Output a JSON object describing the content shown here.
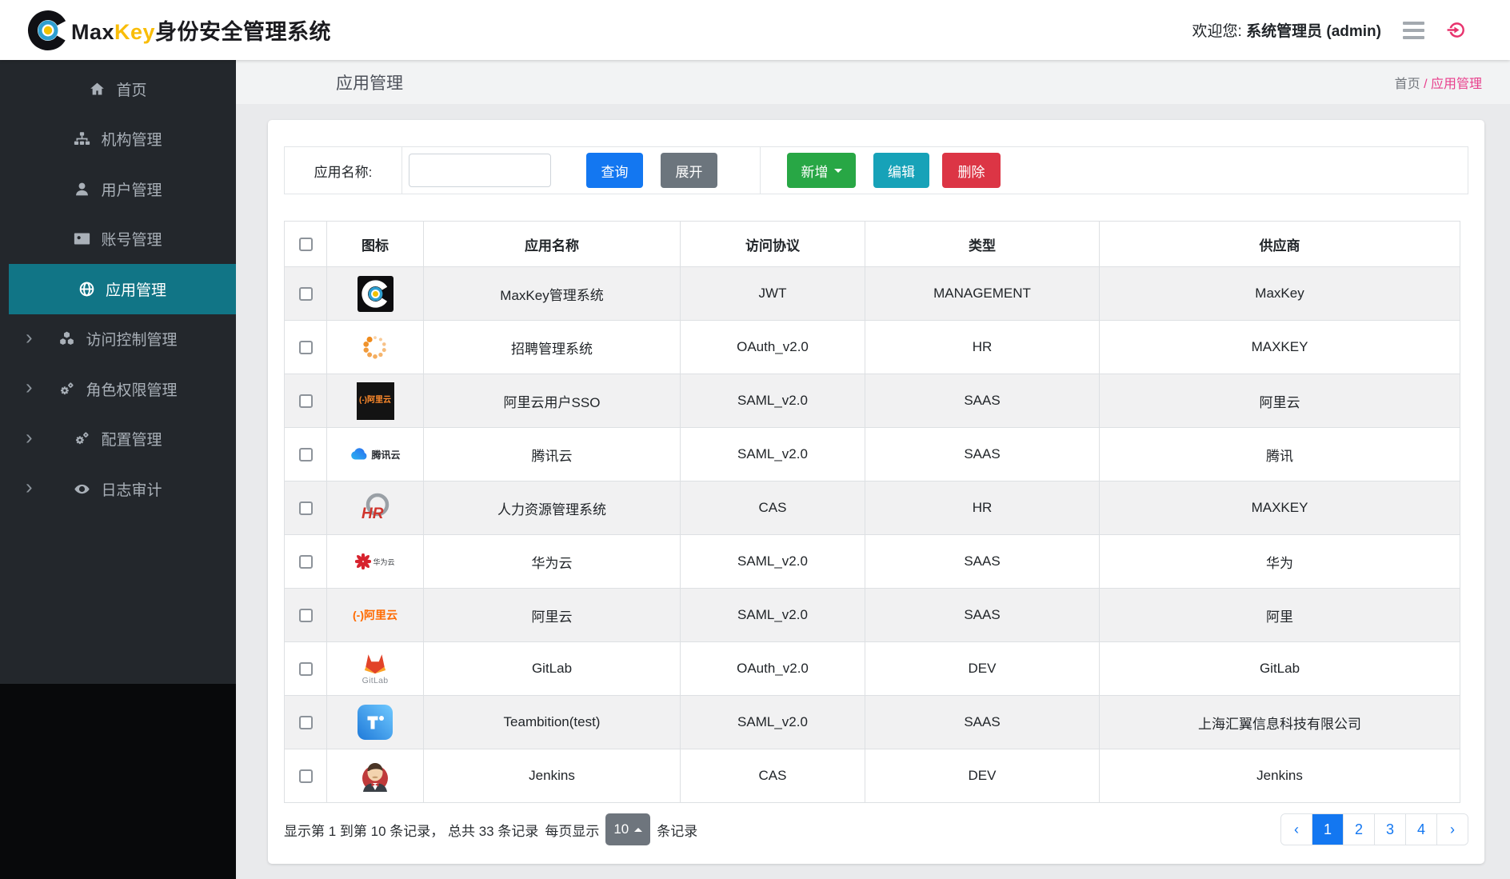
{
  "header": {
    "brand_prefix": "Max",
    "brand_highlight": "Key",
    "brand_suffix": "身份安全管理系统",
    "welcome_prefix": "欢迎您:",
    "welcome_user": "系统管理员 (admin)"
  },
  "icons": {
    "chevron_right": "›"
  },
  "colors": {
    "primary": "#1377f1",
    "secondary": "#6c757d",
    "success": "#28a745",
    "info": "#17a2b8",
    "danger": "#dc3545",
    "active_menu": "#117586",
    "breadcrumb_pink": "#e83e8c",
    "brand_yellow": "#f9bd09"
  },
  "sidebar": {
    "items": [
      {
        "key": "home",
        "label": "首页",
        "icon": "home-icon"
      },
      {
        "key": "org",
        "label": "机构管理",
        "icon": "sitemap-icon"
      },
      {
        "key": "user",
        "label": "用户管理",
        "icon": "user-icon"
      },
      {
        "key": "account",
        "label": "账号管理",
        "icon": "address-card-icon"
      },
      {
        "key": "app",
        "label": "应用管理",
        "icon": "globe-icon",
        "active": true
      },
      {
        "key": "access",
        "label": "访问控制管理",
        "icon": "cubes-icon",
        "has_children": true
      },
      {
        "key": "role",
        "label": "角色权限管理",
        "icon": "gears-icon",
        "has_children": true
      },
      {
        "key": "config",
        "label": "配置管理",
        "icon": "gears-icon",
        "has_children": true
      },
      {
        "key": "audit",
        "label": "日志审计",
        "icon": "eye-icon",
        "has_children": true
      }
    ]
  },
  "page": {
    "title": "应用管理",
    "breadcrumb_home": "首页",
    "breadcrumb_sep": "/",
    "breadcrumb_current": "应用管理"
  },
  "toolbar": {
    "search_label": "应用名称:",
    "search_value": "",
    "query": "查询",
    "expand": "展开",
    "add": "新增",
    "edit": "编辑",
    "delete": "删除"
  },
  "table": {
    "headers": [
      "图标",
      "应用名称",
      "访问协议",
      "类型",
      "供应商"
    ],
    "rows": [
      {
        "icon": "maxkey-logo-icon",
        "icon_text": "",
        "name": "MaxKey管理系统",
        "protocol": "JWT",
        "type": "MANAGEMENT",
        "vendor": "MaxKey"
      },
      {
        "icon": "spinner-dots-icon",
        "icon_text": "",
        "name": "招聘管理系统",
        "protocol": "OAuth_v2.0",
        "type": "HR",
        "vendor": "MAXKEY"
      },
      {
        "icon": "aliyun-dark-icon",
        "icon_text": "(-)阿里云",
        "name": "阿里云用户SSO",
        "protocol": "SAML_v2.0",
        "type": "SAAS",
        "vendor": "阿里云"
      },
      {
        "icon": "tencent-cloud-icon",
        "icon_text": "腾讯云",
        "name": "腾讯云",
        "protocol": "SAML_v2.0",
        "type": "SAAS",
        "vendor": "腾讯"
      },
      {
        "icon": "hr-circle-icon",
        "icon_text": "HR",
        "name": "人力资源管理系统",
        "protocol": "CAS",
        "type": "HR",
        "vendor": "MAXKEY"
      },
      {
        "icon": "huawei-cloud-icon",
        "icon_text": "华为云",
        "name": "华为云",
        "protocol": "SAML_v2.0",
        "type": "SAAS",
        "vendor": "华为"
      },
      {
        "icon": "aliyun-orange-icon",
        "icon_text": "(-)阿里云",
        "name": "阿里云",
        "protocol": "SAML_v2.0",
        "type": "SAAS",
        "vendor": "阿里"
      },
      {
        "icon": "gitlab-icon",
        "icon_text": "GitLab",
        "name": "GitLab",
        "protocol": "OAuth_v2.0",
        "type": "DEV",
        "vendor": "GitLab"
      },
      {
        "icon": "teambition-icon",
        "icon_text": "",
        "name": "Teambition(test)",
        "protocol": "SAML_v2.0",
        "type": "SAAS",
        "vendor": "上海汇翼信息科技有限公司"
      },
      {
        "icon": "jenkins-icon",
        "icon_text": "",
        "name": "Jenkins",
        "protocol": "CAS",
        "type": "DEV",
        "vendor": "Jenkins"
      }
    ]
  },
  "footer": {
    "records_info": "显示第 1 到第 10 条记录， 总共 33 条记录",
    "per_page_prefix": "每页显示",
    "page_size": "10",
    "per_page_suffix": "条记录"
  },
  "pagination": {
    "prev": "‹",
    "pages": [
      "1",
      "2",
      "3",
      "4"
    ],
    "next": "›",
    "active": "1"
  }
}
